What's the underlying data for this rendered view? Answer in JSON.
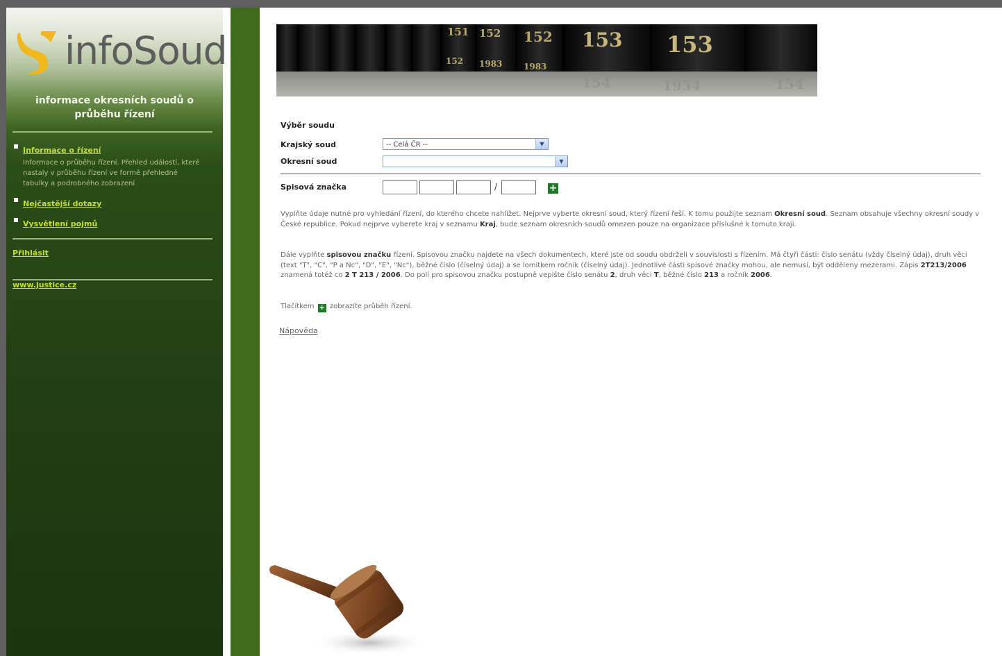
{
  "sidebar": {
    "logo_text": "infoSoud",
    "tagline": "informace okresních soudů o průběhu řízení",
    "menu": [
      {
        "label": "Informace o řízení",
        "desc": "Informace o průběhu řízení. Přehled událostí, které nastaly v průběhu řízení ve formě přehledné tabulky a podrobného zobrazení"
      },
      {
        "label": "Nejčastější dotazy"
      },
      {
        "label": "Vysvětlení pojmů"
      }
    ],
    "login": "Přihlásit",
    "justice_link": "www.justice.cz"
  },
  "banner": {
    "volumes": [
      "151",
      "152",
      "152",
      "153",
      "153"
    ],
    "small_labels": [
      "152",
      "1983",
      "1983"
    ],
    "reflections": [
      "154",
      "1954",
      "154"
    ]
  },
  "form": {
    "title": "Výběr soudu",
    "regional_label": "Krajský soud",
    "regional_value": "-- Celá ČR --",
    "district_label": "Okresní soud",
    "district_value": "",
    "case_label": "Spisová značka",
    "slash": "/",
    "go_symbol": "+"
  },
  "text": {
    "p1_a": "Vyplňte údaje nutné pro vyhledání řízení, do kterého chcete nahlížet. Nejprve vyberte okresní soud, který řízení řeší. K tomu použijte seznam",
    "p1_b": "Okresní soud",
    "p1_c": ". Seznam obsahuje všechny okresní soudy v České republice. Pokud nejprve vyberete kraj v seznamu",
    "p1_d": "Kraj",
    "p1_e": ", bude seznam okresních soudů omezen pouze na organizace příslušné k tomuto kraji.",
    "p2_a": "Dále vyplňte",
    "p2_b": "spisovou značku",
    "p2_c": "řízení. Spisovou značku najdete na všech dokumentech, které jste od soudu obdrželi v souvislosti s řízením. Má čtyři části: číslo senátu (vždy číselný údaj), druh věci (text \"T\", \"C\", \"P a Nc\", \"D\", \"E\", \"Nc\"), běžné číslo (číselný údaj) a se lomítkem ročník (číselný údaj). Jednotlivé části spisové značky mohou, ale nemusí, být odděleny mezerami. Zápis",
    "p2_d": "2T213/2006",
    "p2_e": "znamená totéž co",
    "p2_f": "2 T 213 / 2006",
    "p2_g": ". Do polí pro spisovou značku postupně vepište číslo senátu",
    "p2_h": "2",
    "p2_i": ", druh věci",
    "p2_j": "T",
    "p2_k": ", běžné číslo",
    "p2_l": "213",
    "p2_m": "a ročník",
    "p2_n": "2006",
    "p2_o": ".",
    "p3_a": "Tlačítkem",
    "p3_b": "zobrazíte průběh řízení.",
    "help": "Nápověda"
  },
  "colors": {
    "sidebar_dark": "#233f14",
    "stripe": "#3f6a1c",
    "menu_link": "#c6dc3a",
    "button_green": "#1f7a25"
  },
  "icons": [
    "logo-s-icon",
    "bullet-icon",
    "dropdown-arrow-icon",
    "plus-icon",
    "gavel-icon"
  ]
}
